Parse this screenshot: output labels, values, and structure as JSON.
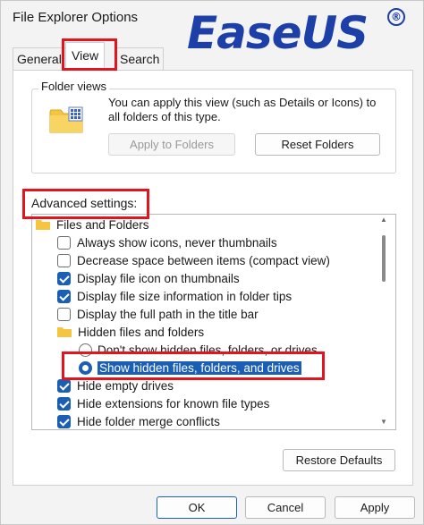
{
  "window": {
    "title": "File Explorer Options"
  },
  "logo": {
    "text": "EaseUS",
    "mark": "®",
    "color": "#1c3fa8"
  },
  "tabs": [
    {
      "label": "General",
      "selected": false
    },
    {
      "label": "View",
      "selected": true
    },
    {
      "label": "Search",
      "selected": false
    }
  ],
  "folder_views": {
    "heading": "Folder views",
    "description": "You can apply this view (such as Details or Icons) to all folders of this type.",
    "apply_label": "Apply to Folders",
    "reset_label": "Reset Folders"
  },
  "advanced": {
    "heading": "Advanced settings:",
    "items": [
      {
        "kind": "folder",
        "label": "Files and Folders"
      },
      {
        "kind": "checkbox",
        "label": "Always show icons, never thumbnails",
        "checked": false
      },
      {
        "kind": "checkbox",
        "label": "Decrease space between items (compact view)",
        "checked": false
      },
      {
        "kind": "checkbox",
        "label": "Display file icon on thumbnails",
        "checked": true
      },
      {
        "kind": "checkbox",
        "label": "Display file size information in folder tips",
        "checked": true
      },
      {
        "kind": "checkbox",
        "label": "Display the full path in the title bar",
        "checked": false
      },
      {
        "kind": "folder",
        "label": "Hidden files and folders"
      },
      {
        "kind": "radio",
        "label": "Don't show hidden files, folders, or drives",
        "checked": false
      },
      {
        "kind": "radio",
        "label": "Show hidden files, folders, and drives",
        "checked": true
      },
      {
        "kind": "checkbox",
        "label": "Hide empty drives",
        "checked": true
      },
      {
        "kind": "checkbox",
        "label": "Hide extensions for known file types",
        "checked": true
      },
      {
        "kind": "checkbox",
        "label": "Hide folder merge conflicts",
        "checked": true
      }
    ],
    "restore_label": "Restore Defaults"
  },
  "footer": {
    "ok_label": "OK",
    "cancel_label": "Cancel",
    "apply_label": "Apply"
  },
  "colors": {
    "highlight_box": "#e2141e",
    "accent": "#1a5fb4",
    "folder": "#f5c542"
  }
}
